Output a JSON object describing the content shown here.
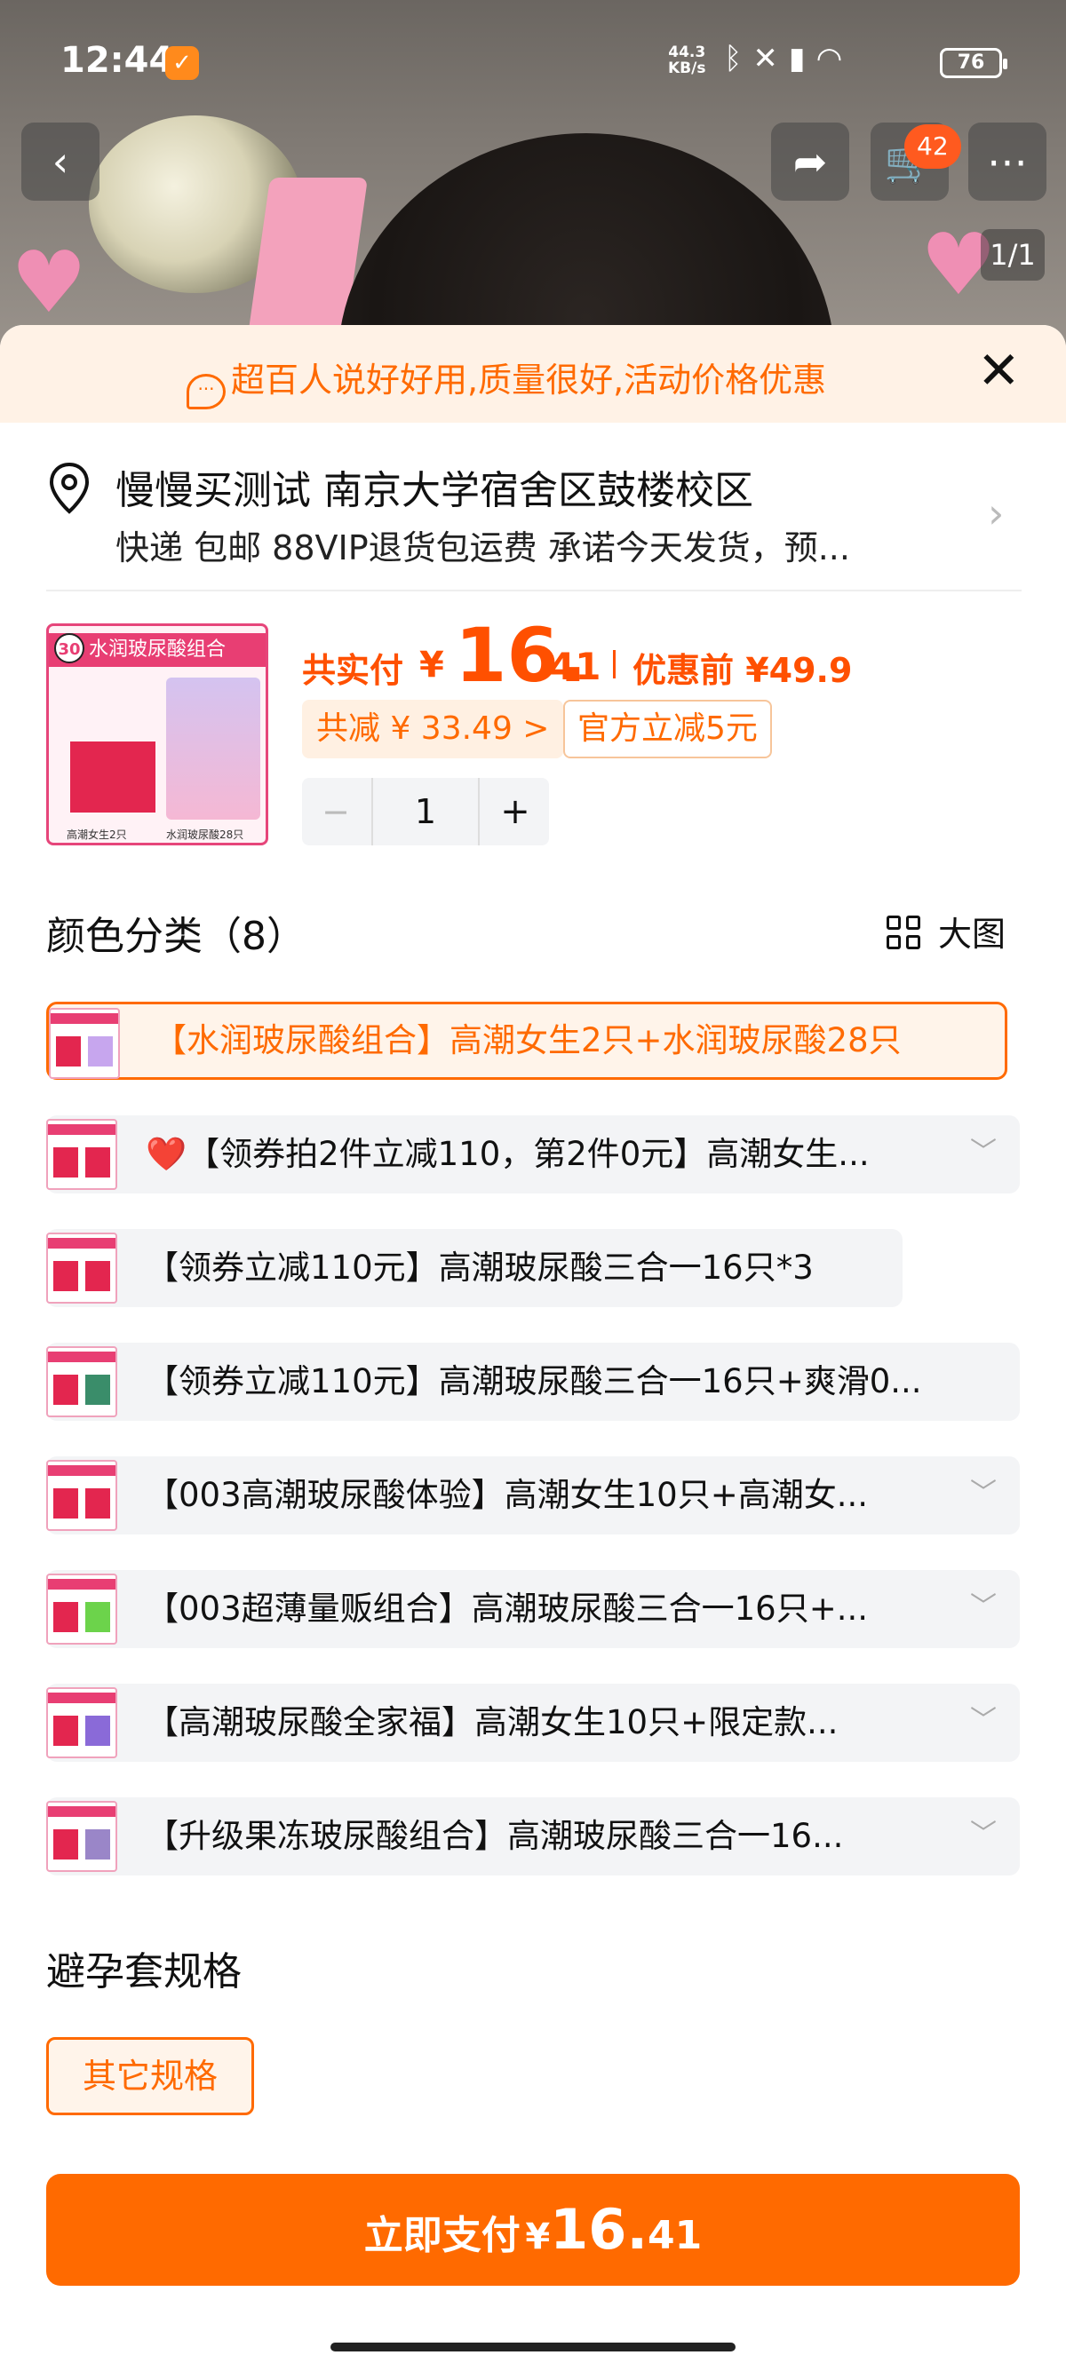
{
  "status": {
    "time": "12:44",
    "net_speed": "44.3",
    "net_unit": "KB/s",
    "battery": "76"
  },
  "header": {
    "cart_badge": "42",
    "pager": "1/1"
  },
  "banner": {
    "text": "超百人说好好用,质量很好,活动价格优惠"
  },
  "address": {
    "name": "慢慢买测试 南京大学宿舍区鼓楼校区",
    "delivery": "快递 包邮 88VIP退货包运费 承诺今天发货，预..."
  },
  "product": {
    "thumb_tag": "水润玻尿酸组合",
    "thumb_num": "30",
    "thumb_caption_left": "高潮女生2只",
    "thumb_caption_right": "水润玻尿酸28只",
    "price_label": "共实付",
    "price_yen": "¥",
    "price_int": "16.",
    "price_dec": "41",
    "original_price": "优惠前 ¥49.9",
    "save_chip": "共减 ¥ 33.49 >",
    "official_chip": "官方立减5元",
    "quantity": "1",
    "minus": "−",
    "plus": "+"
  },
  "colors": {
    "title": "颜色分类（8）",
    "big_view": "大图",
    "options": [
      {
        "label": "【水润玻尿酸组合】高潮女生2只+水润玻尿酸28只",
        "selected": true
      },
      {
        "label": "❤️【领券拍2件立减110，第2件0元】高潮女生...",
        "selected": false
      },
      {
        "label": "【领券立减110元】高潮玻尿酸三合一16只*3",
        "selected": false
      },
      {
        "label": "【领券立减110元】高潮玻尿酸三合一16只+爽滑0...",
        "selected": false
      },
      {
        "label": "【003高潮玻尿酸体验】高潮女生10只+高潮女...",
        "selected": false
      },
      {
        "label": "【003超薄量贩组合】高潮玻尿酸三合一16只+...",
        "selected": false
      },
      {
        "label": "【高潮玻尿酸全家福】高潮女生10只+限定款...",
        "selected": false
      },
      {
        "label": "【升级果冻玻尿酸组合】高潮玻尿酸三合一16...",
        "selected": false
      }
    ]
  },
  "spec": {
    "title": "避孕套规格",
    "option": "其它规格"
  },
  "pay": {
    "label": "立即支付",
    "yen": "¥",
    "int": "16.",
    "dec": "41"
  },
  "theme": {
    "accent": "#ff6a00",
    "price": "#ff5000"
  }
}
